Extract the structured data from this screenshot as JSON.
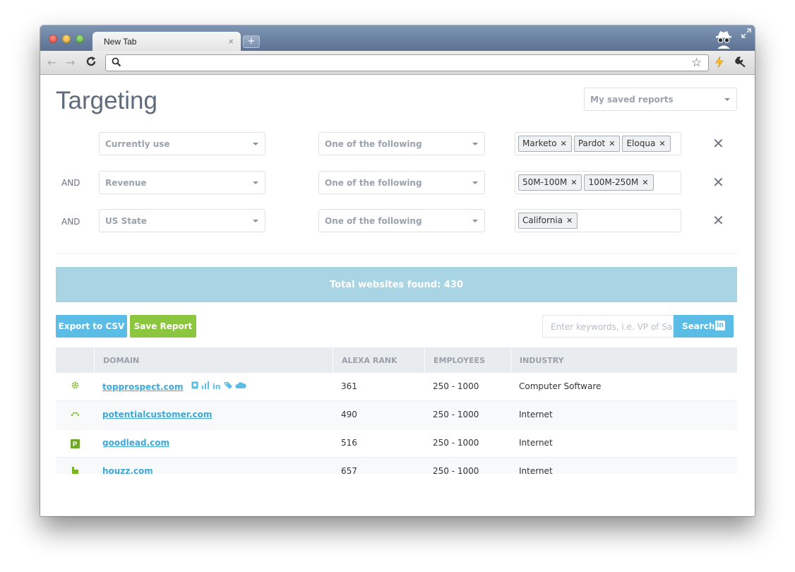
{
  "browser": {
    "tab_title": "New Tab",
    "tab_close": "×",
    "new_tab": "+",
    "omnibox_value": ""
  },
  "page": {
    "title": "Targeting",
    "saved_reports": "My saved reports"
  },
  "filters": [
    {
      "connector": "",
      "field": "Currently use",
      "operator": "One of the following",
      "tags": [
        "Marketo",
        "Pardot",
        "Eloqua"
      ]
    },
    {
      "connector": "AND",
      "field": "Revenue",
      "operator": "One of the following",
      "tags": [
        "50M-100M",
        "100M-250M"
      ]
    },
    {
      "connector": "AND",
      "field": "US State",
      "operator": "One of the following",
      "tags": [
        "California"
      ]
    }
  ],
  "summary": {
    "total_text": "Total websites found: 430"
  },
  "actions": {
    "export": "Export to CSV",
    "save": "Save Report",
    "search_placeholder": "Enter keywords, i.e. VP of Sales",
    "search_button": "Search",
    "linkedin_glyph": "in"
  },
  "table": {
    "headers": [
      "DOMAIN",
      "ALEXA RANK",
      "EMPLOYEES",
      "INDUSTRY"
    ],
    "rows": [
      {
        "favicon": "gear-icon",
        "domain": "topprospect.com",
        "alexa": "361",
        "employees": "250 - 1000",
        "industry": "Computer Software",
        "social": true
      },
      {
        "favicon": "arc-icon",
        "domain": "potentialcustomer.com",
        "alexa": "490",
        "employees": "250 - 1000",
        "industry": "Internet",
        "social": false
      },
      {
        "favicon": "p-box-icon",
        "domain": "goodlead.com",
        "alexa": "516",
        "employees": "250 - 1000",
        "industry": "Internet",
        "social": false
      },
      {
        "favicon": "h-icon",
        "domain": "houzz.com",
        "alexa": "657",
        "employees": "250 - 1000",
        "industry": "Internet",
        "social": false
      }
    ],
    "favicon_glyphs": {
      "p_box": "p"
    },
    "social_glyphs": {
      "linkedin": "in"
    }
  },
  "colors": {
    "accent_blue": "#5bbce6",
    "accent_green": "#8cc63f",
    "banner": "#a9d4e3",
    "title_text": "#5e6b7d"
  }
}
